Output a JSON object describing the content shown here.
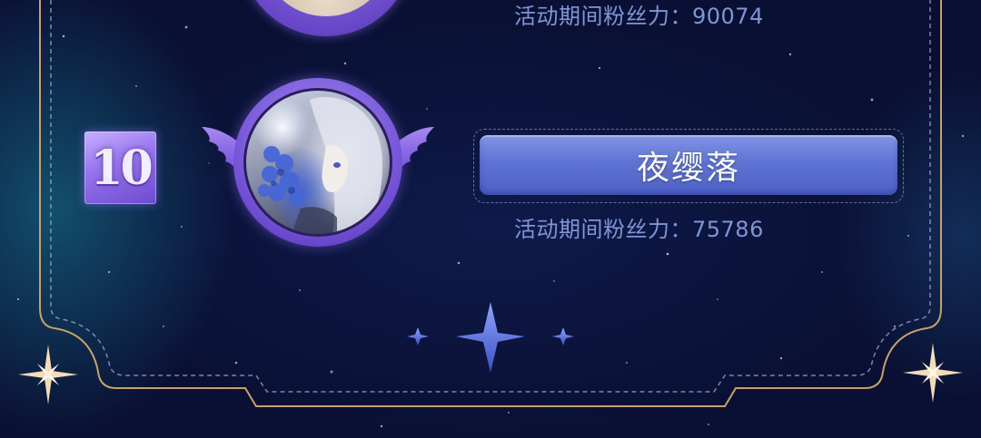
{
  "previous_entry": {
    "fans_label": "活动期间粉丝力：",
    "fans_value": "90074"
  },
  "entry": {
    "rank": "10",
    "name": "夜缨落",
    "fans_label": "活动期间粉丝力：",
    "fans_value": "75786"
  },
  "icons": {
    "wings": "angel-wings-icon",
    "center_decoration": "four-point-star-icon",
    "corner_decoration": "sparkle-star-icon"
  },
  "colors": {
    "background": "#0b1236",
    "frame_gold": "#c9a06a",
    "frame_dash": "#aab6e6",
    "badge_purple": "#8a66e6",
    "name_plate_blue": "#5f73d3",
    "fans_text": "#7f95d6"
  }
}
